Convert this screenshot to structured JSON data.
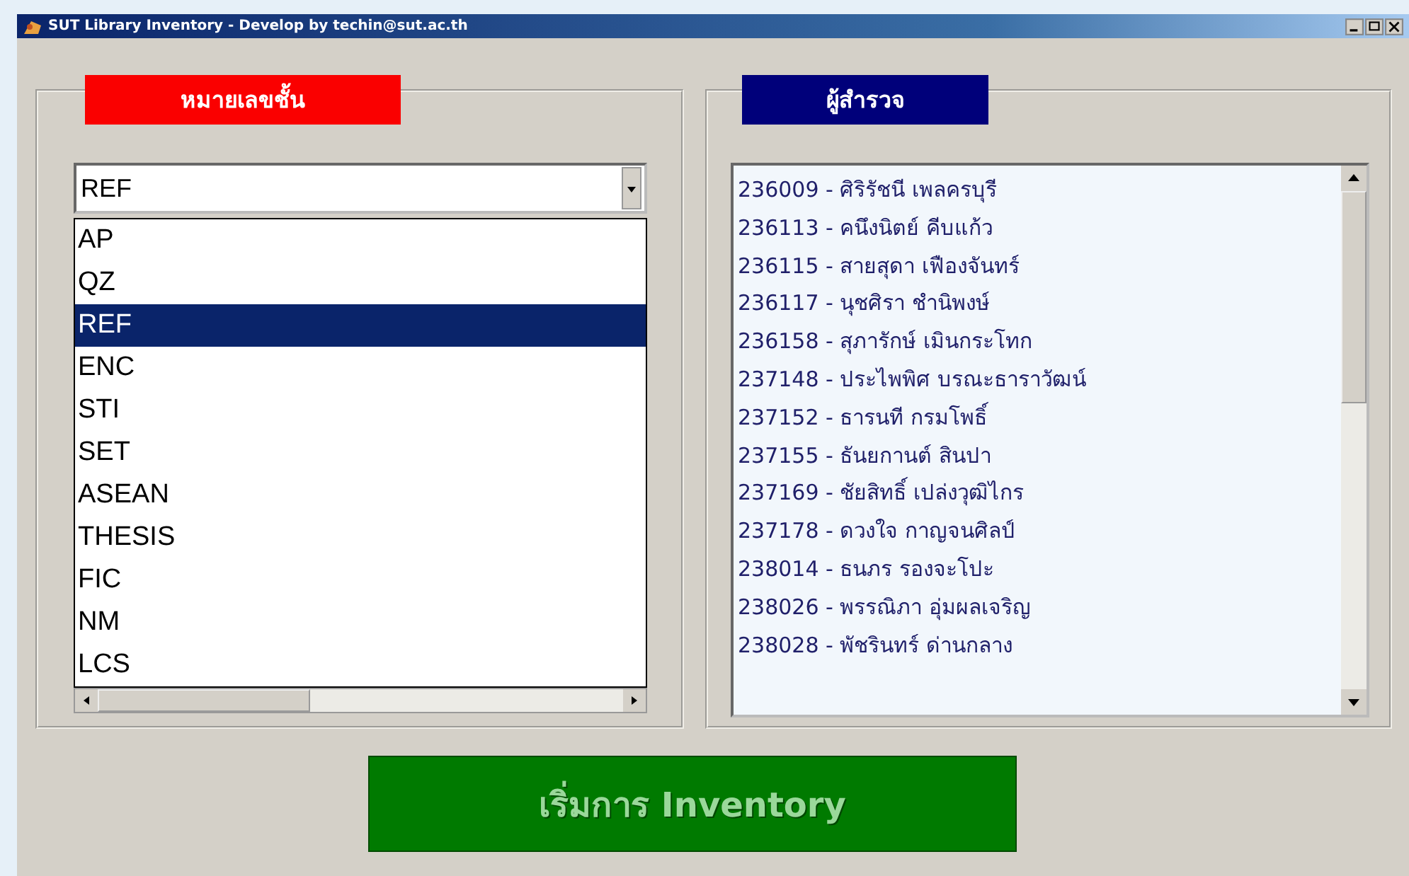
{
  "window": {
    "title": "SUT Library Inventory - Develop by techin@sut.ac.th"
  },
  "shelf_panel": {
    "label": "หมายเลขชั้น",
    "combo": {
      "value": "REF"
    },
    "dropdown": [
      {
        "label": "AP",
        "selected": false
      },
      {
        "label": "QZ",
        "selected": false
      },
      {
        "label": "REF",
        "selected": true
      },
      {
        "label": "ENC",
        "selected": false
      },
      {
        "label": "STI",
        "selected": false
      },
      {
        "label": "SET",
        "selected": false
      },
      {
        "label": "ASEAN",
        "selected": false
      },
      {
        "label": "THESIS",
        "selected": false
      },
      {
        "label": "FIC",
        "selected": false
      },
      {
        "label": "NM",
        "selected": false
      },
      {
        "label": "LCS",
        "selected": false
      }
    ]
  },
  "surveyor_panel": {
    "label": "ผู้สำรวจ",
    "list": [
      "236009 - ศิริรัชนี เพลครบุรี",
      "236113 - คนึงนิตย์ คีบแก้ว",
      "236115 - สายสุดา เฟืองจันทร์",
      "236117 - นุชศิรา ชำนิพงษ์",
      "236158 - สุภารักษ์ เมินกระโทก",
      "237148 - ประไพพิศ บรณะธาราวัฒน์",
      "237152 - ธารนที กรมโพธิ์",
      "237155 - ธันยกานต์ สินปา",
      "237169 - ชัยสิทธิ์ เปล่งวุฒิไกร",
      "237178 - ดวงใจ กาญจนศิลป์",
      "238014 - ธนภร รองจะโปะ",
      "238026 - พรรณิภา อุ่มผลเจริญ",
      "238028 - พัชรินทร์ ด่านกลาง"
    ]
  },
  "start_button": {
    "label": "เริ่มการ Inventory",
    "disabled": true
  }
}
